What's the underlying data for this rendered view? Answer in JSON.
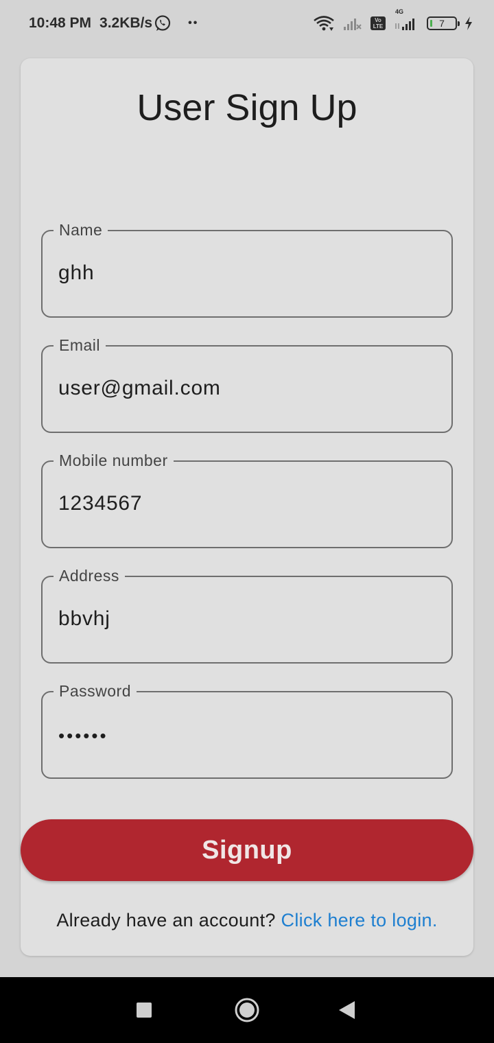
{
  "status_bar": {
    "time": "10:48 PM",
    "net_speed": "3.2KB/s",
    "dots": "••",
    "volte": "Vo LTE",
    "network": "4G",
    "battery_level": "7",
    "icons": [
      "whatsapp-icon",
      "wifi-icon",
      "signal-icon",
      "volte-icon",
      "4g-signal-icon",
      "battery-icon",
      "charging-icon"
    ]
  },
  "page": {
    "title": "User Sign Up"
  },
  "form": {
    "name": {
      "label": "Name",
      "value": "ghh"
    },
    "email": {
      "label": "Email",
      "value": "user@gmail.com"
    },
    "mobile": {
      "label": "Mobile number",
      "value": "1234567"
    },
    "address": {
      "label": "Address",
      "value": "bbvhj"
    },
    "password": {
      "label": "Password",
      "value": "••••••"
    }
  },
  "signup_button": {
    "label": "Signup"
  },
  "login_prompt": {
    "text": "Already have an account? ",
    "link": "Click here to login."
  },
  "colors": {
    "accent": "#b0262f",
    "link": "#1e7fd0",
    "card": "#e0e0e0",
    "background": "#d4d4d4"
  },
  "nav_bar": {
    "icons": [
      "recents-icon",
      "home-icon",
      "back-icon"
    ]
  }
}
